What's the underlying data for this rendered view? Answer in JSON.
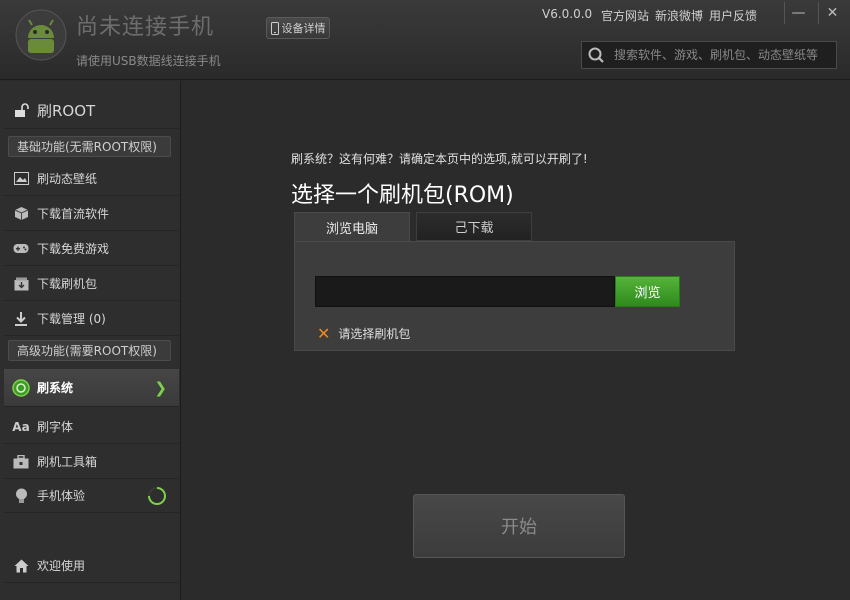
{
  "app": {
    "title": "尚未连接手机",
    "subtitle": "请使用USB数据线连接手机",
    "device_button": "设备详情",
    "version": "V6.0.0.0",
    "links": [
      "官方网站",
      "新浪微博",
      "用户反馈"
    ],
    "window_min": "—",
    "window_close": "✕"
  },
  "search": {
    "placeholder": "搜索软件、游戏、刷机包、动态壁纸等",
    "icon": "search-icon"
  },
  "sidebar": {
    "root": {
      "label": "刷ROOT",
      "icon": "unlock-icon"
    },
    "section_basic": "基础功能(无需ROOT权限)",
    "basic_items": [
      {
        "label": "刷动态壁纸",
        "icon": "wallpaper-icon"
      },
      {
        "label": "下载首流软件",
        "icon": "box-icon"
      },
      {
        "label": "下载免费游戏",
        "icon": "gamepad-icon"
      },
      {
        "label": "下载刷机包",
        "icon": "package-icon"
      },
      {
        "label": "下载管理 (0)",
        "icon": "download-icon"
      }
    ],
    "section_advanced": "高级功能(需要ROOT权限)",
    "advanced_items": [
      {
        "label": "刷系统",
        "icon": "flash-system-icon",
        "active": true
      },
      {
        "label": "刷字体",
        "icon": "font-icon"
      },
      {
        "label": "刷机工具箱",
        "icon": "toolbox-icon"
      },
      {
        "label": "手机体验",
        "icon": "lightbulb-icon"
      }
    ],
    "welcome": {
      "label": "欢迎使用",
      "icon": "home-icon"
    }
  },
  "main": {
    "hint": "刷系统？这有何难？请确定本页中的选项,就可以开刷了!",
    "title": "选择一个刷机包(ROM)",
    "tabs": [
      {
        "label": "浏览电脑",
        "active": true
      },
      {
        "label": "己下载",
        "active": false
      }
    ],
    "path_value": "",
    "browse_label": "浏览",
    "warning": "请选择刷机包",
    "start_label": "开始"
  },
  "colors": {
    "accent_green": "#4caf33",
    "warning_orange": "#f08a1e",
    "background": "#2b2b2b"
  }
}
